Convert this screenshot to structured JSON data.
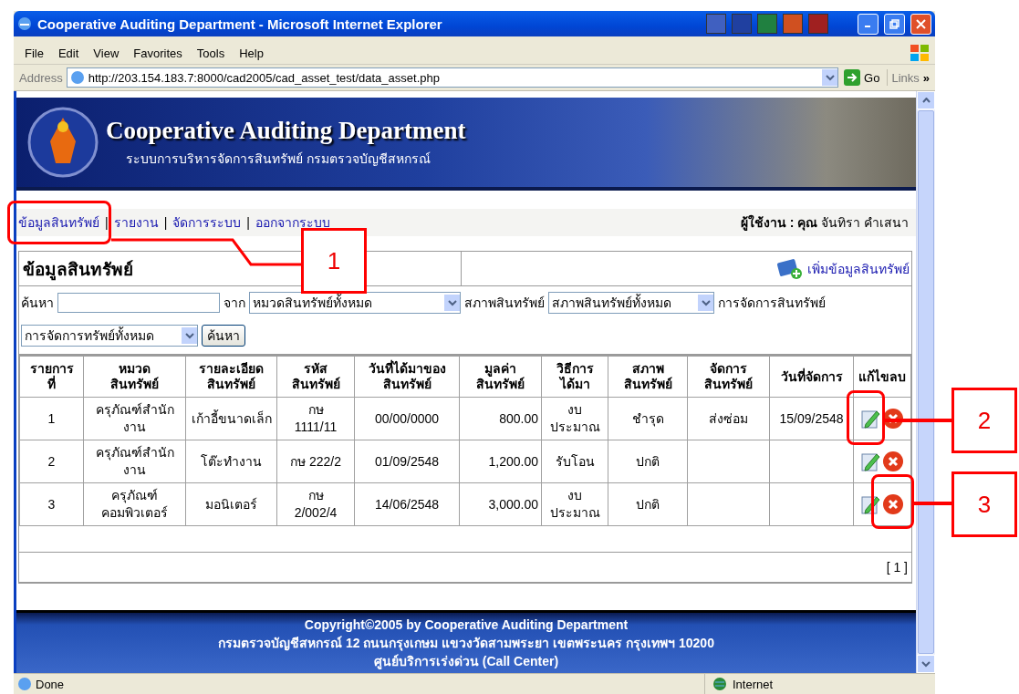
{
  "window": {
    "title": "Cooperative Auditing Department - Microsoft Internet Explorer"
  },
  "menu": [
    "File",
    "Edit",
    "View",
    "Favorites",
    "Tools",
    "Help"
  ],
  "address_bar": {
    "label": "Address",
    "url": "http://203.154.183.7:8000/cad2005/cad_asset_test/data_asset.php",
    "go": "Go",
    "links": "Links",
    "chevron": "»"
  },
  "banner": {
    "title": "Cooperative Auditing Department",
    "subtitle": "ระบบการบริหารจัดการสินทรัพย์ กรมตรวจบัญชีสหกรณ์"
  },
  "nav": {
    "links": [
      "ข้อมูลสินทรัพย์",
      "รายงาน",
      "จัดการระบบ",
      "ออกจากระบบ"
    ],
    "separator": "|",
    "user": "**ผู้ใช้งาน : คุณ** จันทิรา คำเสนา"
  },
  "panel": {
    "title": "ข้อมูลสินทรัพย์",
    "add_link": "เพิ่มข้อมูลสินทรัพย์"
  },
  "search": {
    "label": "ค้นหา",
    "from_label": "จาก",
    "category": "หมวดสินทรัพย์ทั้งหมด",
    "status_label": "สภาพสินทรัพย์",
    "status": "สภาพสินทรัพย์ทั้งหมด",
    "management_label": "การจัดการสินทรัพย์",
    "management": "การจัดการทรัพย์ทั้งหมด",
    "button": "ค้นหา"
  },
  "table": {
    "columns": [
      "รายการ\nที่",
      "หมวด\nสินทรัพย์",
      "รายละเอียด\nสินทรัพย์",
      "รหัส\nสินทรัพย์",
      "วันที่ได้มาของ\nสินทรัพย์",
      "มูลค่า\nสินทรัพย์",
      "วิธีการ\nได้มา",
      "สภาพ\nสินทรัพย์",
      "จัดการ\nสินทรัพย์",
      "วันที่จัดการ",
      "แก้ไขลบ"
    ],
    "rows": [
      {
        "cells": [
          "1",
          "ครุภัณฑ์สำนัก\nงาน",
          "เก้าอี้ขนาดเล็ก",
          "กษ\n1111/11",
          "00/00/0000",
          "800.00",
          "งบ\nประมาณ",
          "ชำรุด",
          "ส่งซ่อม",
          "15/09/2548"
        ]
      },
      {
        "cells": [
          "2",
          "ครุภัณฑ์สำนัก\nงาน",
          "โต๊ะทำงาน",
          "กษ 222/2",
          "01/09/2548",
          "1,200.00",
          "รับโอน",
          "ปกติ",
          null,
          null
        ]
      },
      {
        "cells": [
          "3",
          "ครุภัณฑ์\nคอมพิวเตอร์",
          "มอนิเตอร์",
          "กษ\n2/002/4",
          "14/06/2548",
          "3,000.00",
          "งบ\nประมาณ",
          "ปกติ",
          null,
          null
        ]
      }
    ]
  },
  "pagination": "[ 1 ]",
  "footer": [
    "Copyright©2005 by Cooperative Auditing Department",
    "กรมตรวจบัญชีสหกรณ์ 12 ถนนกรุงเกษม แขวงวัดสามพระยา เขตพระนคร กรุงเทพฯ 10200",
    "ศูนย์บริการเร่งด่วน (Call Center)"
  ],
  "status_bar": {
    "text": "Done",
    "zone": "Internet"
  },
  "callouts": [
    {
      "label": "1"
    },
    {
      "label": "2"
    },
    {
      "label": "3"
    }
  ]
}
